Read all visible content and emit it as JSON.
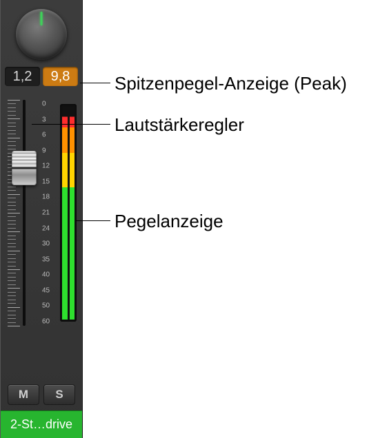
{
  "peak": {
    "left_value": "1,2",
    "right_value": "9,8"
  },
  "fader": {
    "position_percent": 72,
    "scale_labels": [
      "0",
      "3",
      "6",
      "9",
      "12",
      "15",
      "18",
      "21",
      "24",
      "30",
      "35",
      "40",
      "45",
      "50",
      "60"
    ]
  },
  "meter": {
    "level_left_percent": 95,
    "level_right_percent": 95
  },
  "buttons": {
    "mute_label": "M",
    "solo_label": "S"
  },
  "track": {
    "name_display": "2-St…drive"
  },
  "callouts": {
    "peak": "Spitzenpegel-Anzeige (Peak)",
    "fader": "Lautstärkeregler",
    "meter": "Pegelanzeige"
  }
}
